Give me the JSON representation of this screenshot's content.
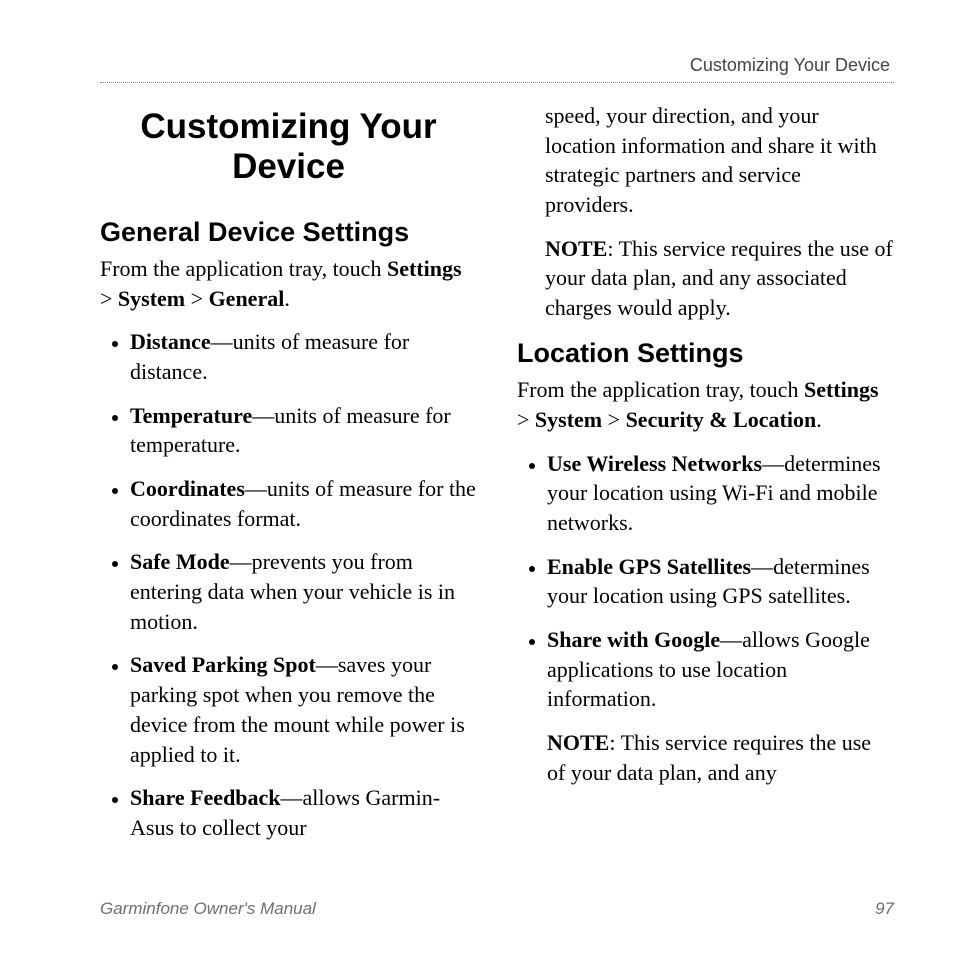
{
  "running_header": "Customizing Your Device",
  "chapter_title": "Customizing Your Device",
  "footer": {
    "manual_title": "Garminfone Owner's Manual",
    "page_number": "97"
  },
  "left": {
    "section_title": "General Device Settings",
    "lead_prefix": "From the application tray, touch ",
    "lead_path_1": "Settings",
    "lead_sep": " > ",
    "lead_path_2": "System",
    "lead_path_3": "General",
    "lead_suffix": ".",
    "items": [
      {
        "term": "Distance",
        "sep": "—",
        "desc": "units of measure for distance."
      },
      {
        "term": "Temperature",
        "sep": "—",
        "desc": "units of measure for temperature."
      },
      {
        "term": "Coordinates",
        "sep": "—",
        "desc": "units of measure for the coordinates format."
      },
      {
        "term": "Safe Mode",
        "sep": "—",
        "desc": "prevents you from entering data when your vehicle is in motion."
      },
      {
        "term": "Saved Parking Spot",
        "sep": "—",
        "desc": "saves your parking spot when you remove the device from the mount while power is applied to it."
      },
      {
        "term": "Share Feedback",
        "sep": "—",
        "desc": "allows Garmin-Asus to collect your"
      }
    ]
  },
  "right": {
    "continuation": "speed, your direction, and your location information and share it with strategic partners and service providers.",
    "note_label": "NOTE",
    "note_text": ": This service requires the use of your data plan, and any associated charges would apply.",
    "section_title": "Location Settings",
    "lead_prefix": "From the application tray, touch ",
    "lead_path_1": "Settings",
    "lead_sep": " > ",
    "lead_path_2": "System",
    "lead_path_3": "Security & Location",
    "lead_suffix": ".",
    "items": [
      {
        "term": "Use Wireless Networks",
        "sep": "—",
        "desc": "determines your location using Wi-Fi and mobile networks."
      },
      {
        "term": "Enable GPS Satellites",
        "sep": "—",
        "desc": "determines your location using GPS satellites."
      },
      {
        "term": "Share with Google",
        "sep": "—",
        "desc": "allows Google applications to use location information."
      }
    ],
    "bottom_note_label": "NOTE",
    "bottom_note_text": ": This service requires the use of your data plan, and any"
  }
}
